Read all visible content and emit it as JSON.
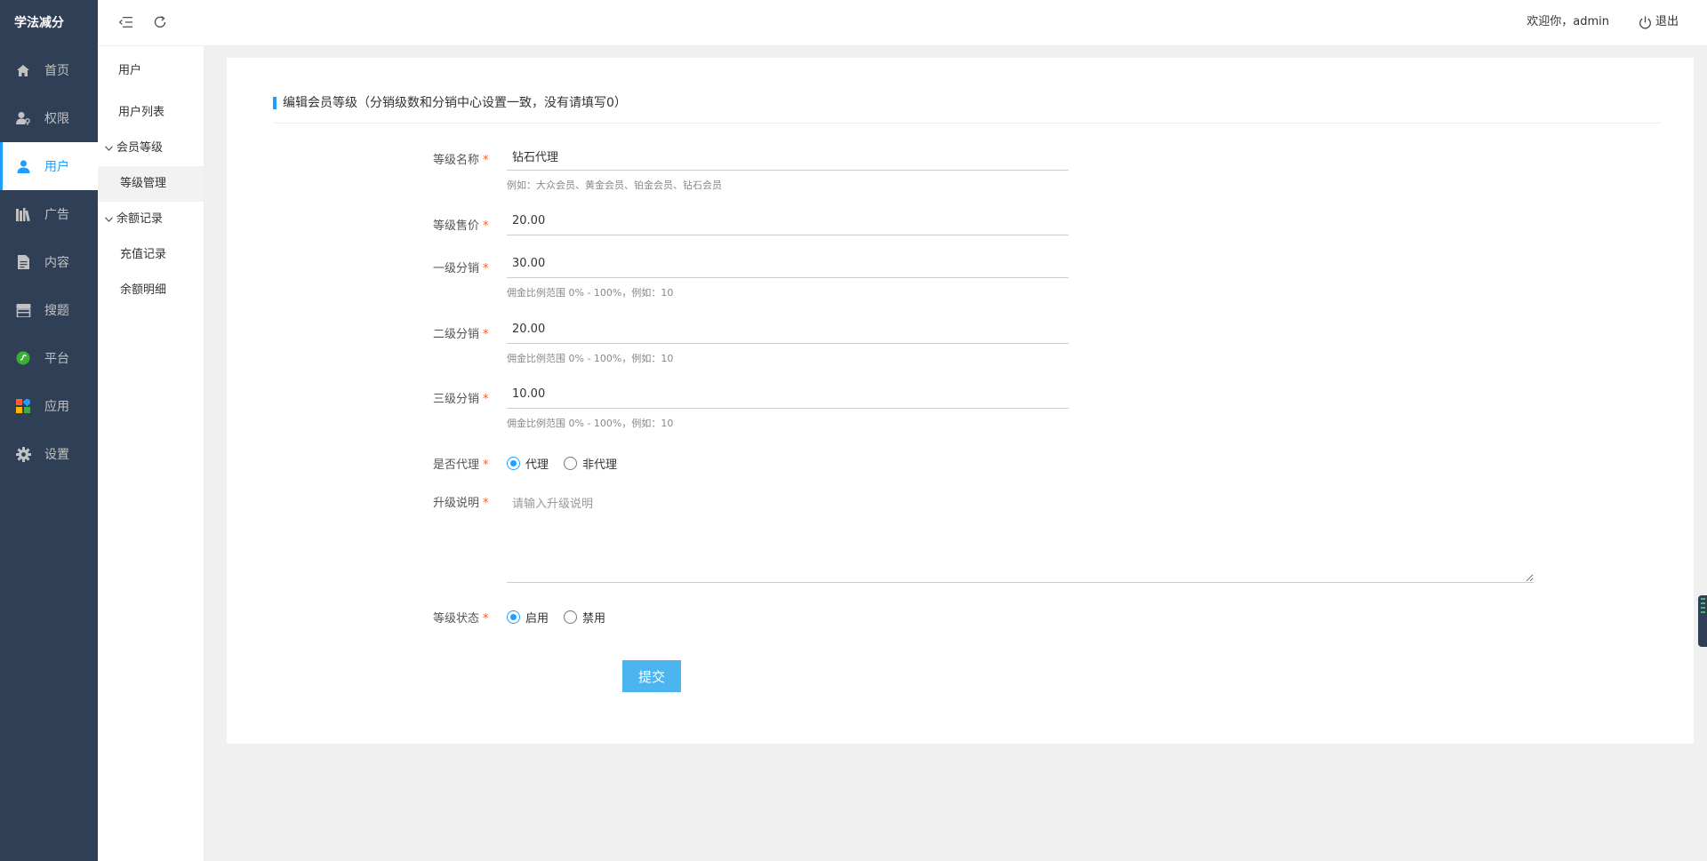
{
  "brand": "学法减分",
  "sidebar": {
    "items": [
      {
        "label": "首页",
        "icon": "home-icon"
      },
      {
        "label": "权限",
        "icon": "user-key-icon"
      },
      {
        "label": "用户",
        "icon": "user-icon",
        "active": true
      },
      {
        "label": "广告",
        "icon": "books-icon"
      },
      {
        "label": "内容",
        "icon": "document-icon"
      },
      {
        "label": "搜题",
        "icon": "store-icon"
      },
      {
        "label": "平台",
        "icon": "platform-icon"
      },
      {
        "label": "应用",
        "icon": "apps-icon"
      },
      {
        "label": "设置",
        "icon": "gear-icon"
      }
    ]
  },
  "submenu": {
    "title": "用户",
    "user_list": "用户列表",
    "member_level_group": "会员等级",
    "level_manage": "等级管理",
    "balance_group": "余额记录",
    "recharge_record": "充值记录",
    "balance_detail": "余额明细"
  },
  "header": {
    "welcome": "欢迎你，admin",
    "logout": "退出"
  },
  "form": {
    "title": "编辑会员等级（分销级数和分销中心设置一致，没有请填写0）",
    "level_name": {
      "label": "等级名称",
      "value": "钻石代理",
      "tip": "例如：大众会员、黄金会员、铂金会员、钻石会员"
    },
    "price": {
      "label": "等级售价",
      "value": "20.00"
    },
    "dist1": {
      "label": "一级分销",
      "value": "30.00",
      "tip": "佣金比例范围 0% - 100%，例如：10"
    },
    "dist2": {
      "label": "二级分销",
      "value": "20.00",
      "tip": "佣金比例范围 0% - 100%，例如：10"
    },
    "dist3": {
      "label": "三级分销",
      "value": "10.00",
      "tip": "佣金比例范围 0% - 100%，例如：10"
    },
    "is_agent": {
      "label": "是否代理",
      "options": [
        "代理",
        "非代理"
      ],
      "selected": "代理"
    },
    "upgrade_desc": {
      "label": "升级说明",
      "placeholder": "请输入升级说明",
      "value": ""
    },
    "status": {
      "label": "等级状态",
      "options": [
        "启用",
        "禁用"
      ],
      "selected": "启用"
    },
    "required_mark": "*",
    "submit": "提交"
  },
  "colors": {
    "sidebar_bg": "#2f4056",
    "accent": "#1e9fff",
    "submit_bg": "#4cb5f0",
    "required": "#ff5722"
  }
}
